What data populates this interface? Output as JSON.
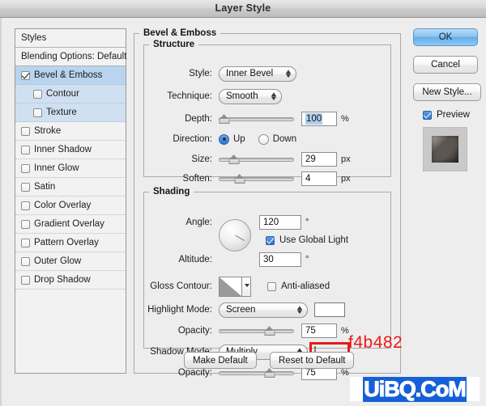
{
  "window": {
    "title": "Layer Style"
  },
  "styles_panel": {
    "header": "Styles",
    "blending_options": "Blending Options: Default",
    "items": [
      {
        "label": "Bevel & Emboss",
        "checked": true,
        "selected": true,
        "sub": false
      },
      {
        "label": "Contour",
        "checked": false,
        "selected": true,
        "sub": true
      },
      {
        "label": "Texture",
        "checked": false,
        "selected": true,
        "sub": true
      },
      {
        "label": "Stroke",
        "checked": false,
        "selected": false,
        "sub": false
      },
      {
        "label": "Inner Shadow",
        "checked": false,
        "selected": false,
        "sub": false
      },
      {
        "label": "Inner Glow",
        "checked": false,
        "selected": false,
        "sub": false
      },
      {
        "label": "Satin",
        "checked": false,
        "selected": false,
        "sub": false
      },
      {
        "label": "Color Overlay",
        "checked": false,
        "selected": false,
        "sub": false
      },
      {
        "label": "Gradient Overlay",
        "checked": false,
        "selected": false,
        "sub": false
      },
      {
        "label": "Pattern Overlay",
        "checked": false,
        "selected": false,
        "sub": false
      },
      {
        "label": "Outer Glow",
        "checked": false,
        "selected": false,
        "sub": false
      },
      {
        "label": "Drop Shadow",
        "checked": false,
        "selected": false,
        "sub": false
      }
    ]
  },
  "panel": {
    "title": "Bevel & Emboss",
    "structure": {
      "legend": "Structure",
      "style_label": "Style:",
      "style_value": "Inner Bevel",
      "technique_label": "Technique:",
      "technique_value": "Smooth",
      "depth_label": "Depth:",
      "depth_value": "100",
      "depth_unit": "%",
      "depth_percent": 8,
      "direction_label": "Direction:",
      "direction_up": "Up",
      "direction_down": "Down",
      "direction_selected": "Up",
      "size_label": "Size:",
      "size_value": "29",
      "size_unit": "px",
      "size_percent": 20,
      "soften_label": "Soften:",
      "soften_value": "4",
      "soften_unit": "px",
      "soften_percent": 28
    },
    "shading": {
      "legend": "Shading",
      "angle_label": "Angle:",
      "angle_value": "120",
      "angle_unit": "°",
      "global_light_label": "Use Global Light",
      "global_light_checked": true,
      "altitude_label": "Altitude:",
      "altitude_value": "30",
      "altitude_unit": "°",
      "gloss_contour_label": "Gloss Contour:",
      "anti_aliased_label": "Anti-aliased",
      "anti_aliased_checked": false,
      "highlight_mode_label": "Highlight Mode:",
      "highlight_mode_value": "Screen",
      "highlight_color": "#ffffff",
      "highlight_opacity_label": "Opacity:",
      "highlight_opacity_value": "75",
      "highlight_opacity_unit": "%",
      "highlight_opacity_percent": 68,
      "shadow_mode_label": "Shadow Mode:",
      "shadow_mode_value": "Multiply",
      "shadow_color": "#f4b482",
      "shadow_opacity_label": "Opacity:",
      "shadow_opacity_value": "75",
      "shadow_opacity_unit": "%",
      "shadow_opacity_percent": 68
    },
    "annotation": {
      "text": "f4b482",
      "color": "#f01818"
    },
    "buttons": {
      "make_default": "Make Default",
      "reset_to_default": "Reset to Default"
    }
  },
  "right_panel": {
    "ok": "OK",
    "cancel": "Cancel",
    "new_style": "New Style...",
    "preview_label": "Preview",
    "preview_checked": true
  },
  "watermark": {
    "text": "UiBQ.CoM"
  }
}
